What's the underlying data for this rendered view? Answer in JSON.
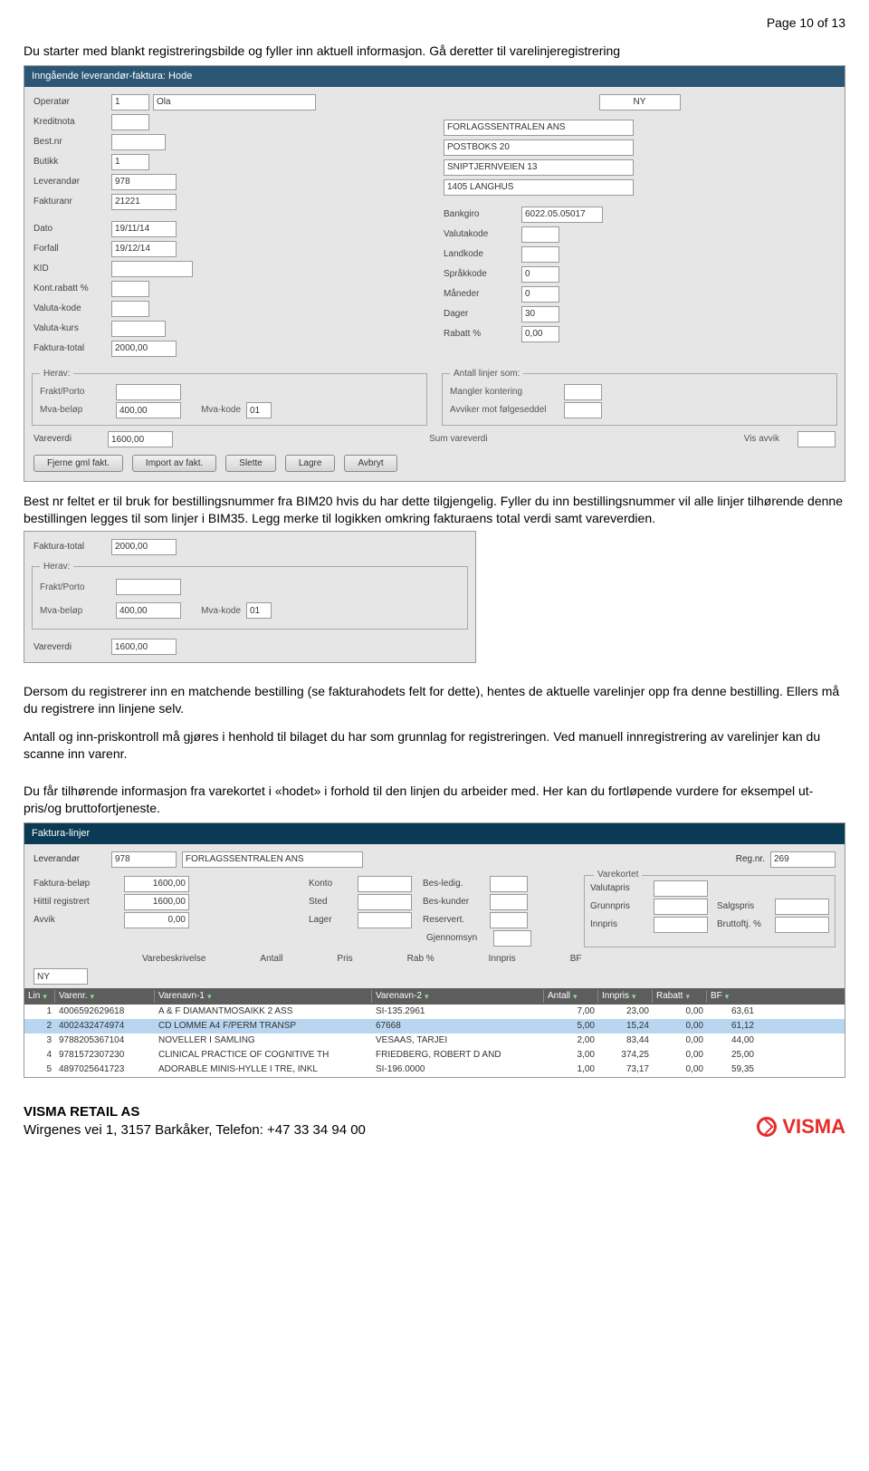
{
  "page": {
    "header": "Page 10 of 13"
  },
  "text": {
    "intro1": "Du starter med blankt registreringsbilde og fyller inn aktuell informasjon. Gå deretter til varelinjeregistrering",
    "mid1": "Best nr feltet er til bruk for bestillingsnummer fra BIM20 hvis du har dette tilgjengelig. Fyller du inn bestillingsnummer vil alle linjer tilhørende denne bestillingen legges til som linjer i BIM35. Legg merke til logikken omkring fakturaens total verdi samt vareverdien.",
    "mid2": "Dersom du registrerer inn en matchende bestilling (se fakturahodets felt for dette), hentes de aktuelle varelinjer opp fra denne bestilling. Ellers må du registrere inn linjene selv.",
    "mid3": "Antall og inn-priskontroll må gjøres i henhold til bilaget du har som grunnlag for registreringen. Ved manuell innregistrering av varelinjer kan du scanne inn varenr.",
    "mid4": "Du får tilhørende informasjon fra varekortet i «hodet» i forhold til den linjen du arbeider med. Her kan du fortløpende vurdere for eksempel ut-pris/og bruttofortjeneste."
  },
  "hode": {
    "title": "Inngående leverandør-faktura: Hode",
    "labels": {
      "operator": "Operatør",
      "kreditnota": "Kreditnota",
      "bestnr": "Best.nr",
      "butikk": "Butikk",
      "leverandor": "Leverandør",
      "fakturanr": "Fakturanr",
      "dato": "Dato",
      "forfall": "Forfall",
      "kid": "KID",
      "kontrabatt": "Kont.rabatt %",
      "valutakode": "Valuta-kode",
      "valutakurs": "Valuta-kurs",
      "fakturatotal": "Faktura-total",
      "bankgiro": "Bankgiro",
      "valutakode2": "Valutakode",
      "landkode": "Landkode",
      "sprakkode": "Språkkode",
      "maneder": "Måneder",
      "dager": "Dager",
      "rabattpct": "Rabatt %",
      "mangler": "Mangler kontering",
      "avviker": "Avviker mot følgeseddel",
      "herav": "Herav:",
      "antallsom": "Antall linjer som:",
      "fraktporto": "Frakt/Porto",
      "mvabelop": "Mva-beløp",
      "mvakode": "Mva-kode",
      "vareverdi": "Vareverdi",
      "sumvareverdi": "Sum vareverdi",
      "visavvik": "Vis avvik"
    },
    "values": {
      "operator": "1",
      "operator_name": "Ola",
      "ny": "NY",
      "company": "FORLAGSSENTRALEN ANS",
      "addr1": "POSTBOKS 20",
      "addr2": "SNIPTJERNVEIEN 13",
      "addr3": "1405 LANGHUS",
      "butikk": "1",
      "leverandor": "978",
      "fakturanr": "21221",
      "dato": "19/11/14",
      "forfall": "19/12/14",
      "bankgiro": "6022.05.05017",
      "sprakkode": "0",
      "maneder": "0",
      "dager": "30",
      "rabattpct": "0,00",
      "fakturatotal": "2000,00",
      "mvabelop": "400,00",
      "mvakode": "01",
      "vareverdi": "1600,00"
    },
    "buttons": [
      "Fjerne gml fakt.",
      "Import av fakt.",
      "Slette",
      "Lagre",
      "Avbryt"
    ]
  },
  "small": {
    "title": "Faktura-total",
    "labels": {
      "fakturatotal": "Faktura-total",
      "herav": "Herav:",
      "fraktporto": "Frakt/Porto",
      "mvabelop": "Mva-beløp",
      "mvakode": "Mva-kode",
      "vareverdi": "Vareverdi"
    },
    "values": {
      "fakturatotal": "2000,00",
      "mvabelop": "400,00",
      "mvakode": "01",
      "vareverdi": "1600,00"
    }
  },
  "linjer": {
    "title": "Faktura-linjer",
    "labels": {
      "leverandor": "Leverandør",
      "regnr": "Reg.nr.",
      "fakturabelop": "Faktura-beløp",
      "hittil": "Hittil registrert",
      "avvik": "Avvik",
      "konto": "Konto",
      "sted": "Sted",
      "lager": "Lager",
      "besledig": "Bes-ledig.",
      "beskunder": "Bes-kunder",
      "reservert": "Reservert.",
      "gjennomsyn": "Gjennomsyn",
      "varekortet": "Varekortet",
      "valutapris": "Valutapris",
      "grunnpris": "Grunnpris",
      "innpris": "Innpris",
      "salgspris": "Salgspris",
      "bruttoftj": "Bruttoftj. %",
      "varebeskrivelse": "Varebeskrivelse",
      "antall": "Antall",
      "pris": "Pris",
      "rabpct": "Rab %",
      "innpris2": "Innpris",
      "bf": "BF"
    },
    "values": {
      "leverandor": "978",
      "levnavn": "FORLAGSSENTRALEN ANS",
      "regnr": "269",
      "fakturabelop": "1600,00",
      "hittil": "1600,00",
      "avvik": "0,00",
      "ny": "NY"
    },
    "grid": {
      "headers": [
        "Lin",
        "Varenr.",
        "Varenavn-1",
        "Varenavn-2",
        "Antall",
        "Innpris",
        "Rabatt",
        "BF"
      ],
      "rows": [
        {
          "lin": "1",
          "varenr": "4006592629618",
          "n1": "A & F DIAMANTMOSAIKK 2 ASS",
          "n2": "SI-135.2961",
          "antall": "7,00",
          "innpris": "23,00",
          "rabatt": "0,00",
          "bf": "63,61"
        },
        {
          "lin": "2",
          "varenr": "4002432474974",
          "n1": "CD LOMME A4 F/PERM TRANSP",
          "n2": "67668",
          "antall": "5,00",
          "innpris": "15,24",
          "rabatt": "0,00",
          "bf": "61,12"
        },
        {
          "lin": "3",
          "varenr": "9788205367104",
          "n1": "NOVELLER I SAMLING",
          "n2": "VESAAS, TARJEI",
          "antall": "2,00",
          "innpris": "83,44",
          "rabatt": "0,00",
          "bf": "44,00"
        },
        {
          "lin": "4",
          "varenr": "9781572307230",
          "n1": "CLINICAL PRACTICE OF COGNITIVE TH",
          "n2": "FRIEDBERG, ROBERT D AND",
          "antall": "3,00",
          "innpris": "374,25",
          "rabatt": "0,00",
          "bf": "25,00"
        },
        {
          "lin": "5",
          "varenr": "4897025641723",
          "n1": "ADORABLE MINIS-HYLLE I TRE, INKL",
          "n2": "SI-196.0000",
          "antall": "1,00",
          "innpris": "73,17",
          "rabatt": "0,00",
          "bf": "59,35"
        }
      ]
    }
  },
  "footer": {
    "company": "VISMA RETAIL AS",
    "address": "Wirgenes vei 1, 3157 Barkåker, Telefon: +47 33 34 94 00",
    "logo": "VISMA"
  }
}
